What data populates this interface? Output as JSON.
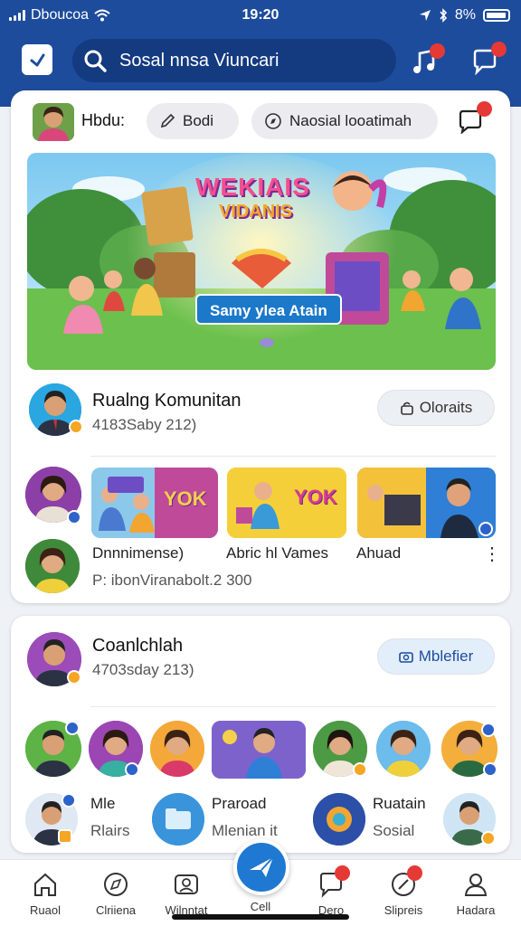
{
  "status_bar": {
    "carrier": "Dboucoa",
    "time": "19:20",
    "battery": "8%"
  },
  "header": {
    "search_text": "Sosal nnsa Viuncari"
  },
  "composer": {
    "label": "Hbdu:",
    "pill1": "Bodi",
    "pill2": "Naosial looatimah"
  },
  "banner": {
    "title_line1": "WEKIAIS",
    "title_line2": "VIDANIS",
    "ribbon": "Samy ylea Atain"
  },
  "community1": {
    "title": "Rualng Komunitan",
    "subtitle": "4183Saby 212)",
    "button": "Oloraits",
    "row_caption": "Dnnnimense)",
    "row_caption2": "Abric hl Vames",
    "row_caption3": "Ahuad",
    "row_sub": "P: ibonViranabolt.2 300",
    "thumb1_text": "YOK",
    "thumb2_text": "YOK"
  },
  "community2": {
    "title": "Coanlchlah",
    "subtitle": "4703sday 213)",
    "button": "Mblefier",
    "items": [
      {
        "line1": "Mle",
        "line2": "Rlairs"
      },
      {
        "line1": "Praroad",
        "line2": "Mlenian it"
      },
      {
        "line1": "Ruatain",
        "line2": "Sosial"
      }
    ]
  },
  "nav": [
    {
      "label": "Ruaol"
    },
    {
      "label": "Clriiena"
    },
    {
      "label": "Wilnntat"
    },
    {
      "label": "Cell"
    },
    {
      "label": "Dero"
    },
    {
      "label": "Slipreis"
    },
    {
      "label": "Hadara"
    }
  ],
  "colors": {
    "header": "#1e4c9c",
    "accent": "#1f78d1",
    "badge": "#e53935"
  }
}
